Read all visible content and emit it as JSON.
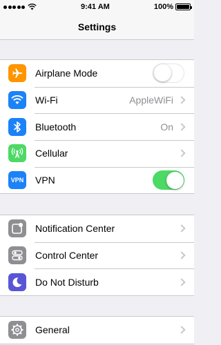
{
  "status_bar": {
    "time": "9:41 AM",
    "battery": "100%",
    "signal_icon": "signal-dots-icon",
    "wifi_icon": "wifi-icon",
    "battery_icon": "battery-icon"
  },
  "nav": {
    "title": "Settings"
  },
  "colors": {
    "background": "#efeff4",
    "airplane": "#ff9500",
    "wifi": "#1b82f7",
    "bluetooth": "#1b82f7",
    "cellular": "#4cd964",
    "vpn": "#1b82f7",
    "notification": "#8e8e93",
    "control": "#8e8e93",
    "dnd": "#5856d6",
    "general": "#8e8e93",
    "toggle_on": "#4cd964"
  },
  "groups": [
    {
      "rows": [
        {
          "label": "Airplane Mode",
          "icon": "airplane-icon",
          "toggle": false
        },
        {
          "label": "Wi-Fi",
          "icon": "wifi-icon",
          "value": "AppleWiFi"
        },
        {
          "label": "Bluetooth",
          "icon": "bluetooth-icon",
          "value": "On"
        },
        {
          "label": "Cellular",
          "icon": "cellular-icon"
        },
        {
          "label": "VPN",
          "icon": "vpn-icon",
          "icon_text": "VPN",
          "toggle": true
        }
      ]
    },
    {
      "rows": [
        {
          "label": "Notification Center",
          "icon": "notification-center-icon"
        },
        {
          "label": "Control Center",
          "icon": "control-center-icon"
        },
        {
          "label": "Do Not Disturb",
          "icon": "moon-icon"
        }
      ]
    },
    {
      "rows": [
        {
          "label": "General",
          "icon": "gear-icon"
        }
      ]
    }
  ]
}
